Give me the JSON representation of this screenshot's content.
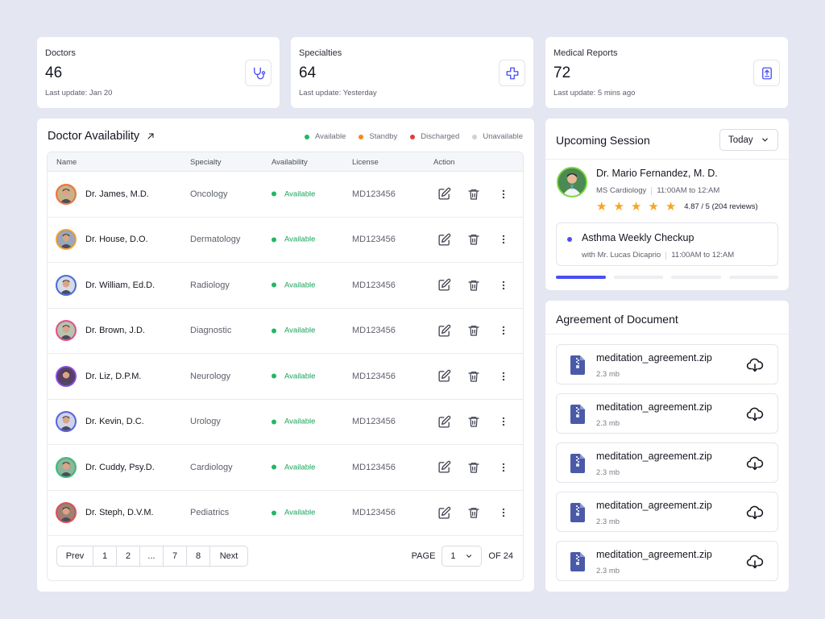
{
  "stats": [
    {
      "label": "Doctors",
      "value": "46",
      "update": "Last update: Jan 20",
      "icon": "stethoscope-icon"
    },
    {
      "label": "Specialties",
      "value": "64",
      "update": "Last update: Yesterday",
      "icon": "medical-cross-icon"
    },
    {
      "label": "Medical Reports",
      "value": "72",
      "update": "Last update: 5 mins ago",
      "icon": "report-upload-icon"
    }
  ],
  "availability": {
    "title": "Doctor Availability",
    "legend": [
      {
        "label": "Available",
        "color": "#1fb864"
      },
      {
        "label": "Standby",
        "color": "#f08a1d"
      },
      {
        "label": "Discharged",
        "color": "#e8383d"
      },
      {
        "label": "Unavailable",
        "color": "#cfd1d8"
      }
    ],
    "columns": {
      "name": "Name",
      "specialty": "Specialty",
      "availability": "Availability",
      "license": "License",
      "action": "Action"
    },
    "rows": [
      {
        "name": "Dr. James, M.D.",
        "specialty": "Oncology",
        "availability": "Available",
        "license": "MD123456",
        "ring": "#f0763a"
      },
      {
        "name": "Dr. House, D.O.",
        "specialty": "Dermatology",
        "availability": "Available",
        "license": "MD123456",
        "ring": "#f5a33a"
      },
      {
        "name": "Dr. William, Ed.D.",
        "specialty": "Radiology",
        "availability": "Available",
        "license": "MD123456",
        "ring": "#4a6ee0"
      },
      {
        "name": "Dr. Brown, J.D.",
        "specialty": "Diagnostic",
        "availability": "Available",
        "license": "MD123456",
        "ring": "#e8508a"
      },
      {
        "name": "Dr. Liz, D.P.M.",
        "specialty": "Neurology",
        "availability": "Available",
        "license": "MD123456",
        "ring": "#8a4fe0"
      },
      {
        "name": "Dr. Kevin, D.C.",
        "specialty": "Urology",
        "availability": "Available",
        "license": "MD123456",
        "ring": "#5a63e8"
      },
      {
        "name": "Dr. Cuddy, Psy.D.",
        "specialty": "Cardiology",
        "availability": "Available",
        "license": "MD123456",
        "ring": "#3bbf7a"
      },
      {
        "name": "Dr. Steph, D.V.M.",
        "specialty": "Pediatrics",
        "availability": "Available",
        "license": "MD123456",
        "ring": "#e0505a"
      }
    ],
    "pagination": {
      "prev": "Prev",
      "pages": [
        "1",
        "2",
        "...",
        "7",
        "8"
      ],
      "next": "Next",
      "page_label": "PAGE",
      "current": "1",
      "of_label": "OF 24"
    }
  },
  "session": {
    "title": "Upcoming Session",
    "filter": "Today",
    "doctor": "Dr. Mario Fernandez, M. D.",
    "specialty": "MS Cardiology",
    "time": "11:00AM to 12:AM",
    "stars": 5,
    "rating": "4.87 / 5 (204 reviews)",
    "checkup_title": "Asthma Weekly Checkup",
    "checkup_with": "with Mr. Lucas Dicaprio",
    "checkup_time": "11:00AM to 12:AM",
    "accent": "#4b4ff0"
  },
  "agreement": {
    "title": "Agreement of Document",
    "files": [
      {
        "name": "meditation_agreement.zip",
        "size": "2.3 mb"
      },
      {
        "name": "meditation_agreement.zip",
        "size": "2.3 mb"
      },
      {
        "name": "meditation_agreement.zip",
        "size": "2.3 mb"
      },
      {
        "name": "meditation_agreement.zip",
        "size": "2.3 mb"
      },
      {
        "name": "meditation_agreement.zip",
        "size": "2.3 mb"
      }
    ]
  }
}
